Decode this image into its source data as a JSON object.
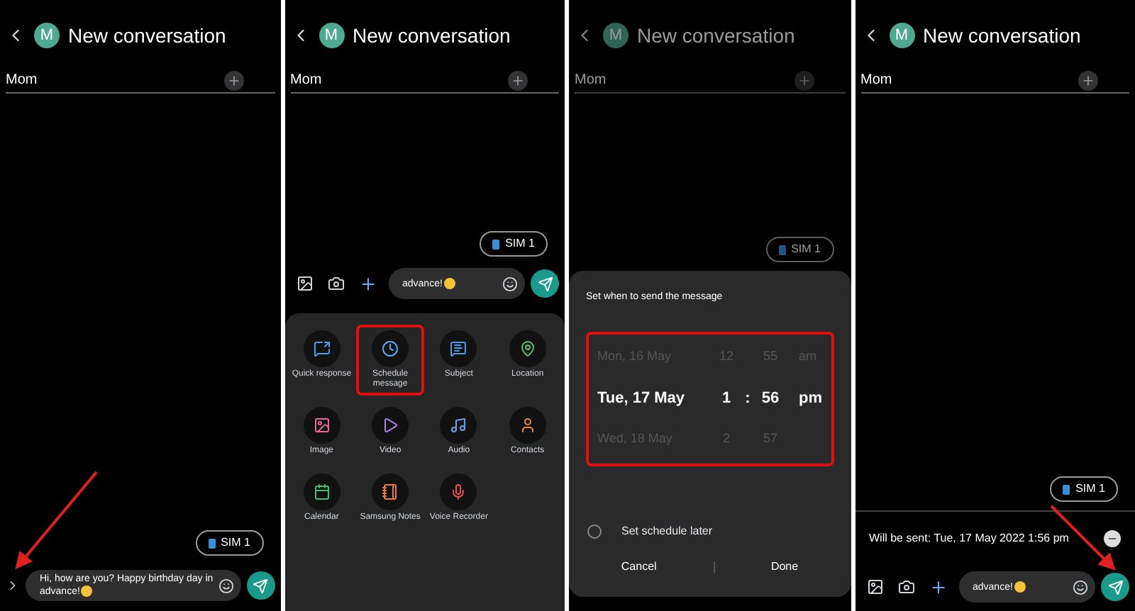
{
  "panels": [
    {
      "kind": "compose",
      "dimmed": false,
      "header": {
        "avatar": "M",
        "title": "New conversation"
      },
      "recipient": "Mom",
      "sim": "SIM 1",
      "composer": {
        "value": "Hi, how are you? Happy birthday day in advance!",
        "arrow": true
      }
    },
    {
      "kind": "attach",
      "dimmed": false,
      "header": {
        "avatar": "M",
        "title": "New conversation"
      },
      "recipient": "Mom",
      "sim": "SIM 1",
      "composer": {
        "value": "advance!",
        "arrow": false
      },
      "attachments": [
        {
          "label": "Quick response",
          "color": "#4a9de8",
          "highlighted": false
        },
        {
          "label": "Schedule message",
          "color": "#5aa6f0",
          "highlighted": true
        },
        {
          "label": "Subject",
          "color": "#4a9de8",
          "highlighted": false
        },
        {
          "label": "Location",
          "color": "#5fbf6a",
          "highlighted": false
        },
        {
          "label": "Image",
          "color": "#e86aa0",
          "highlighted": false
        },
        {
          "label": "Video",
          "color": "#b07ae8",
          "highlighted": false
        },
        {
          "label": "Audio",
          "color": "#6a9ee8",
          "highlighted": false
        },
        {
          "label": "Contacts",
          "color": "#f08a4a",
          "highlighted": false
        },
        {
          "label": "Calendar",
          "color": "#3fbf7a",
          "highlighted": false
        },
        {
          "label": "Samsung Notes",
          "color": "#f0783a",
          "highlighted": false
        },
        {
          "label": "Voice Recorder",
          "color": "#e8504a",
          "highlighted": false
        }
      ]
    },
    {
      "kind": "schedule",
      "dimmed": true,
      "header": {
        "avatar": "M",
        "title": "New conversation"
      },
      "recipient": "Mom",
      "sim": "SIM 1",
      "dialog": {
        "title": "Set when to send the message",
        "highlighted": true,
        "separator": ":",
        "rows": [
          {
            "date": "Mon, 16 May",
            "hour": "12",
            "minute": "55",
            "ampm": "am",
            "selected": false
          },
          {
            "date": "Tue, 17 May",
            "hour": "1",
            "minute": "56",
            "ampm": "pm",
            "selected": true
          },
          {
            "date": "Wed, 18 May",
            "hour": "2",
            "minute": "57",
            "selected": false
          }
        ],
        "later": {
          "label": "Set schedule later",
          "checked": false
        },
        "buttons": [
          "Cancel",
          "Done"
        ]
      }
    },
    {
      "kind": "scheduled",
      "dimmed": false,
      "header": {
        "avatar": "M",
        "title": "New conversation"
      },
      "recipient": "Mom",
      "sim": "SIM 1",
      "schedule_note": "Will be sent: Tue, 17 May 2022 1:56 pm",
      "composer": {
        "value": "advance!",
        "arrow": true
      }
    }
  ]
}
